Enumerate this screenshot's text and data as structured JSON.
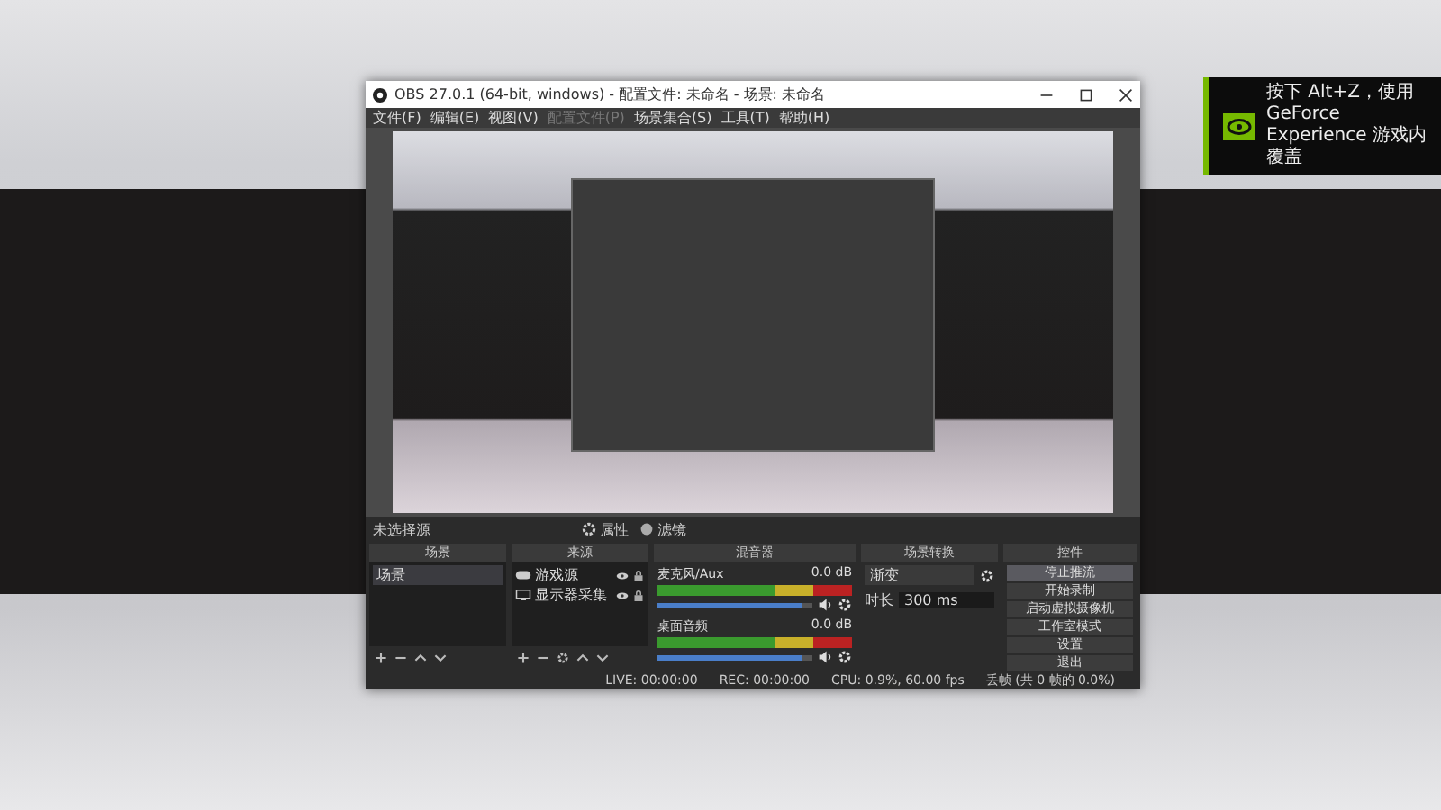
{
  "window": {
    "title": "OBS 27.0.1 (64-bit, windows) - 配置文件: 未命名 - 场景: 未命名"
  },
  "menu": [
    {
      "label": "文件(F)",
      "disabled": false
    },
    {
      "label": "编辑(E)",
      "disabled": false
    },
    {
      "label": "视图(V)",
      "disabled": false
    },
    {
      "label": "配置文件(P)",
      "disabled": true
    },
    {
      "label": "场景集合(S)",
      "disabled": false
    },
    {
      "label": "工具(T)",
      "disabled": false
    },
    {
      "label": "帮助(H)",
      "disabled": false
    }
  ],
  "source_bar": {
    "label": "未选择源",
    "properties": "属性",
    "filters": "滤镜"
  },
  "scenes": {
    "title": "场景",
    "items": [
      {
        "label": "场景",
        "selected": true
      }
    ]
  },
  "sources": {
    "title": "来源",
    "items": [
      {
        "label": "游戏源",
        "kind": "game"
      },
      {
        "label": "显示器采集",
        "kind": "monitor"
      }
    ]
  },
  "mixer": {
    "title": "混音器",
    "channels": [
      {
        "name": "麦克风/Aux",
        "reading": "0.0 dB",
        "level": 0.93
      },
      {
        "name": "桌面音频",
        "reading": "0.0 dB",
        "level": 0.93
      }
    ]
  },
  "transitions": {
    "title": "场景转换",
    "transition": "渐变",
    "duration_label": "时长",
    "duration": "300 ms"
  },
  "controls": {
    "title": "控件",
    "buttons": [
      {
        "label": "停止推流",
        "selected": true
      },
      {
        "label": "开始录制",
        "selected": false
      },
      {
        "label": "启动虚拟摄像机",
        "selected": false
      },
      {
        "label": "工作室模式",
        "selected": false
      },
      {
        "label": "设置",
        "selected": false
      },
      {
        "label": "退出",
        "selected": false
      }
    ]
  },
  "status": {
    "live": "LIVE: 00:00:00",
    "rec": "REC: 00:00:00",
    "cpu": "CPU: 0.9%, 60.00 fps",
    "dropped": "丢帧 (共 0 帧的 0.0%)"
  },
  "notification": {
    "text": "按下 Alt+Z，使用 GeForce Experience 游戏内覆盖"
  }
}
